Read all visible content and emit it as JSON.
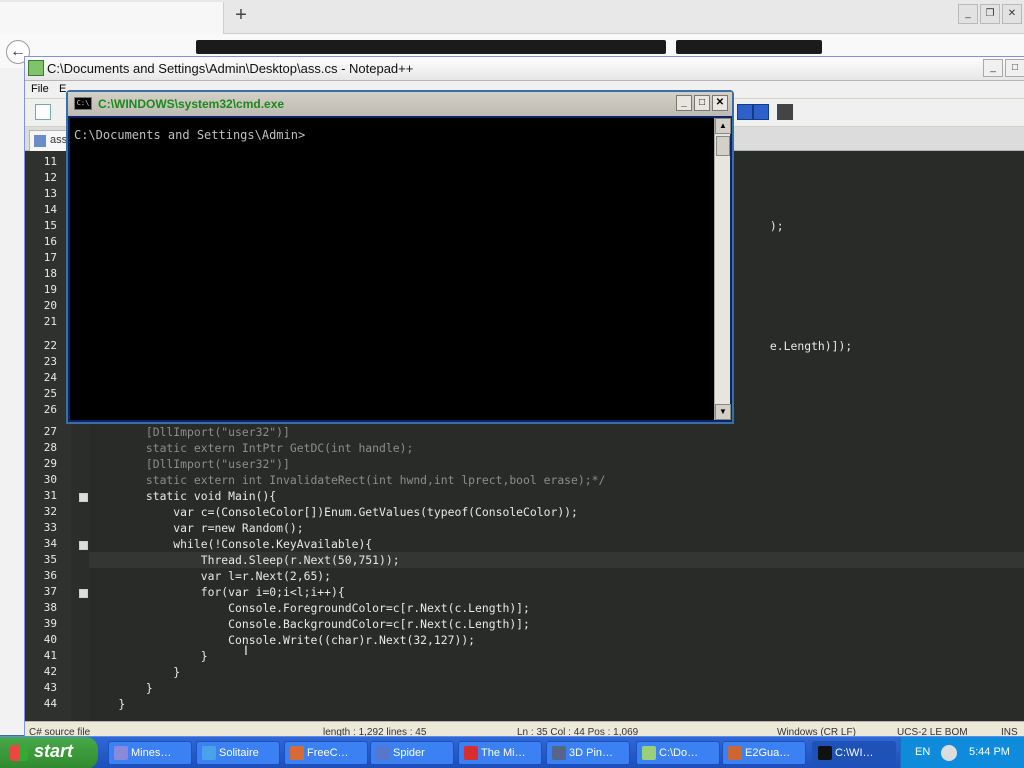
{
  "browser": {
    "tab_label": "",
    "newtab": "+",
    "back": "←"
  },
  "npp": {
    "title": "C:\\Documents and Settings\\Admin\\Desktop\\ass.cs - Notepad++",
    "menu": {
      "file": "File",
      "edit": "E"
    },
    "tab_label": "ass",
    "winbtns": [
      "_",
      "□",
      "✕"
    ]
  },
  "editor": {
    "lines": [
      {
        "n": "11",
        "t": ""
      },
      {
        "n": "12",
        "t": ""
      },
      {
        "n": "13",
        "t": ""
      },
      {
        "n": "14",
        "t": ""
      },
      {
        "n": "15",
        "t": "                                                                                                   );"
      },
      {
        "n": "16",
        "t": ""
      },
      {
        "n": "17",
        "t": ""
      },
      {
        "n": "18",
        "t": ""
      },
      {
        "n": "19",
        "t": ""
      },
      {
        "n": "20",
        "t": ""
      },
      {
        "n": "21",
        "t": ""
      },
      {
        "n": "22",
        "t": "                                                                                                   e.Length)]);"
      },
      {
        "n": "23",
        "t": ""
      },
      {
        "n": "24",
        "t": ""
      },
      {
        "n": "25",
        "t": ""
      },
      {
        "n": "26",
        "t": ""
      },
      {
        "n": "27",
        "t": "        [DllImport(\"user32\")]"
      },
      {
        "n": "28",
        "t": "        static extern IntPtr GetDC(int handle);"
      },
      {
        "n": "29",
        "t": "        [DllImport(\"user32\")]"
      },
      {
        "n": "30",
        "t": "        static extern int InvalidateRect(int hwnd,int lprect,bool erase);*/"
      },
      {
        "n": "31",
        "t": "        static void Main(){"
      },
      {
        "n": "32",
        "t": "            var c=(ConsoleColor[])Enum.GetValues(typeof(ConsoleColor));"
      },
      {
        "n": "33",
        "t": "            var r=new Random();"
      },
      {
        "n": "34",
        "t": "            while(!Console.KeyAvailable){"
      },
      {
        "n": "35",
        "t": "                Thread.Sleep(r.Next(50,751));"
      },
      {
        "n": "36",
        "t": "                var l=r.Next(2,65);"
      },
      {
        "n": "37",
        "t": "                for(var i=0;i<l;i++){"
      },
      {
        "n": "38",
        "t": "                    Console.ForegroundColor=c[r.Next(c.Length)];"
      },
      {
        "n": "39",
        "t": "                    Console.BackgroundColor=c[r.Next(c.Length)];"
      },
      {
        "n": "40",
        "t": "                    Console.Write((char)r.Next(32,127));"
      },
      {
        "n": "41",
        "t": "                }"
      },
      {
        "n": "42",
        "t": "            }"
      },
      {
        "n": "43",
        "t": "        }"
      },
      {
        "n": "44",
        "t": "    }"
      }
    ]
  },
  "status": {
    "type": "C# source file",
    "length": "length : 1,292    lines : 45",
    "pos": "Ln : 35    Col : 44    Pos : 1,069",
    "eol": "Windows (CR LF)",
    "enc": "UCS-2 LE BOM",
    "ins": "INS"
  },
  "cmd": {
    "title": "C:\\WINDOWS\\system32\\cmd.exe",
    "icon": "C:\\",
    "prompt": "C:\\Documents and Settings\\Admin>",
    "winbtns": [
      "_",
      "□",
      "✕"
    ]
  },
  "taskbar": {
    "start": "start",
    "tasks": [
      {
        "label": "Mines…",
        "color": "#8a8ad8"
      },
      {
        "label": "Solitaire",
        "color": "#4aa3e8"
      },
      {
        "label": "FreeC…",
        "color": "#d86a3a"
      },
      {
        "label": "Spider",
        "color": "#5577cc"
      },
      {
        "label": "The Mi…",
        "color": "#d82e2e"
      },
      {
        "label": "3D Pin…",
        "color": "#556688"
      },
      {
        "label": "C:\\Do…",
        "color": "#9ccf7a"
      },
      {
        "label": "E2Gua…",
        "color": "#cc6633"
      },
      {
        "label": "C:\\WI…",
        "color": "#111111"
      }
    ],
    "lang": "EN",
    "clock": "5:44 PM"
  },
  "colors": {
    "editor_bg": "#282b28",
    "cmd_bg": "#000000",
    "taskbar": "#245edb"
  }
}
